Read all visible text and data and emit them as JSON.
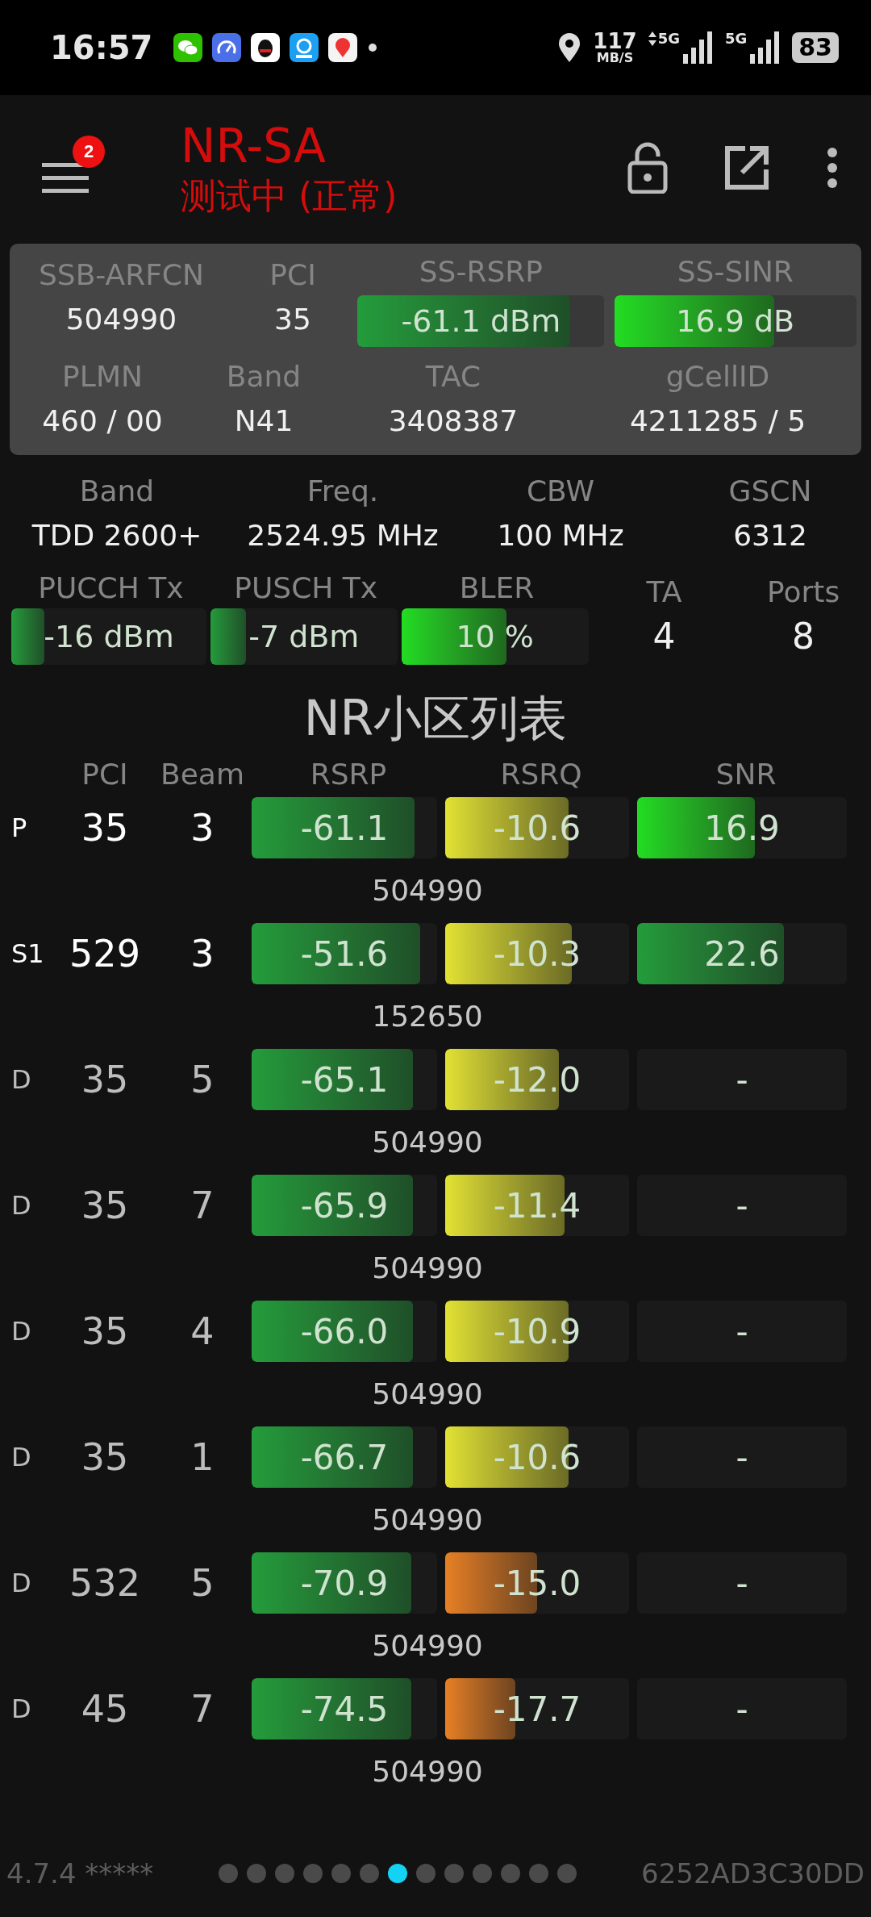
{
  "status_bar": {
    "time": "16:57",
    "net_speed": "117",
    "net_speed_unit": "MB/S",
    "signal_labels": [
      "5G",
      "5G"
    ],
    "battery": "83"
  },
  "app_bar": {
    "menu_badge": "2",
    "title": "NR-SA",
    "subtitle": "测试中 (正常)"
  },
  "serving_cell": {
    "row_1": [
      {
        "label": "SSB-ARFCN",
        "value": "504990"
      },
      {
        "label": "PCI",
        "value": "35"
      },
      {
        "label": "SS-RSRP",
        "value": "-61.1 dBm",
        "level": 0.86,
        "color": "#239c3b"
      },
      {
        "label": "SS-SINR",
        "value": "16.9 dB",
        "level": 0.66,
        "color": "#22dd22"
      }
    ],
    "row_2": [
      {
        "label": "PLMN",
        "value": "460 / 00"
      },
      {
        "label": "Band",
        "value": "N41"
      },
      {
        "label": "TAC",
        "value": "3408387"
      },
      {
        "label": "gCellID",
        "value": "4211285 / 5"
      }
    ]
  },
  "carrier": {
    "row_1": [
      {
        "label": "Band",
        "value": "TDD 2600+"
      },
      {
        "label": "Freq.",
        "value": "2524.95 MHz"
      },
      {
        "label": "CBW",
        "value": "100 MHz"
      },
      {
        "label": "GSCN",
        "value": "6312"
      }
    ],
    "row_2": [
      {
        "label": "PUCCH Tx",
        "value": "-16 dBm",
        "level": 0.17,
        "color": "#239c3b"
      },
      {
        "label": "PUSCH Tx",
        "value": "-7 dBm",
        "level": 0.19,
        "color": "#239c3b"
      },
      {
        "label": "BLER",
        "value": "10 %",
        "level": 0.56,
        "color": "#22dd22"
      },
      {
        "label": "TA",
        "value": "4"
      },
      {
        "label": "Ports",
        "value": "8"
      }
    ]
  },
  "cell_list": {
    "title": "NR小区列表",
    "columns": [
      "PCI",
      "Beam",
      "RSRP",
      "RSRQ",
      "SNR"
    ],
    "rows": [
      {
        "type": "P",
        "kind": "serving",
        "pci": "35",
        "beam": "3",
        "rsrp": {
          "value": "-61.1",
          "level": 0.88,
          "color": "#239c3b"
        },
        "rsrq": {
          "value": "-10.6",
          "level": 0.67,
          "color": "#e2e234"
        },
        "snr": {
          "value": "16.9",
          "level": 0.56,
          "color": "#22dd22"
        },
        "arfcn": "504990"
      },
      {
        "type": "S1",
        "kind": "serving",
        "pci": "529",
        "beam": "3",
        "rsrp": {
          "value": "-51.6",
          "level": 0.91,
          "color": "#239c3b"
        },
        "rsrq": {
          "value": "-10.3",
          "level": 0.69,
          "color": "#e2e234"
        },
        "snr": {
          "value": "22.6",
          "level": 0.7,
          "color": "#239c3b"
        },
        "arfcn": "152650"
      },
      {
        "type": "D",
        "kind": "neighbor",
        "pci": "35",
        "beam": "5",
        "rsrp": {
          "value": "-65.1",
          "level": 0.87,
          "color": "#239c3b"
        },
        "rsrq": {
          "value": "-12.0",
          "level": 0.62,
          "color": "#e2e234"
        },
        "snr": {
          "value": "-"
        },
        "arfcn": "504990"
      },
      {
        "type": "D",
        "kind": "neighbor",
        "pci": "35",
        "beam": "7",
        "rsrp": {
          "value": "-65.9",
          "level": 0.87,
          "color": "#239c3b"
        },
        "rsrq": {
          "value": "-11.4",
          "level": 0.65,
          "color": "#e2e234"
        },
        "snr": {
          "value": "-"
        },
        "arfcn": "504990"
      },
      {
        "type": "D",
        "kind": "neighbor",
        "pci": "35",
        "beam": "4",
        "rsrp": {
          "value": "-66.0",
          "level": 0.87,
          "color": "#239c3b"
        },
        "rsrq": {
          "value": "-10.9",
          "level": 0.67,
          "color": "#e2e234"
        },
        "snr": {
          "value": "-"
        },
        "arfcn": "504990"
      },
      {
        "type": "D",
        "kind": "neighbor",
        "pci": "35",
        "beam": "1",
        "rsrp": {
          "value": "-66.7",
          "level": 0.87,
          "color": "#239c3b"
        },
        "rsrq": {
          "value": "-10.6",
          "level": 0.67,
          "color": "#e2e234"
        },
        "snr": {
          "value": "-"
        },
        "arfcn": "504990"
      },
      {
        "type": "D",
        "kind": "neighbor",
        "pci": "532",
        "beam": "5",
        "rsrp": {
          "value": "-70.9",
          "level": 0.86,
          "color": "#239c3b"
        },
        "rsrq": {
          "value": "-15.0",
          "level": 0.5,
          "color": "#e88024"
        },
        "snr": {
          "value": "-"
        },
        "arfcn": "504990"
      },
      {
        "type": "D",
        "kind": "neighbor",
        "pci": "45",
        "beam": "7",
        "rsrp": {
          "value": "-74.5",
          "level": 0.86,
          "color": "#239c3b"
        },
        "rsrq": {
          "value": "-17.7",
          "level": 0.38,
          "color": "#e88024"
        },
        "snr": {
          "value": "-"
        },
        "arfcn": "504990"
      }
    ]
  },
  "footer": {
    "version": "4.7.4 *****",
    "pages": [
      {
        "selected": false
      },
      {
        "selected": false
      },
      {
        "selected": false
      },
      {
        "selected": false
      },
      {
        "selected": false
      },
      {
        "selected": false
      },
      {
        "selected": true
      },
      {
        "selected": false
      },
      {
        "selected": false
      },
      {
        "selected": false
      },
      {
        "selected": false
      },
      {
        "selected": false
      },
      {
        "selected": false
      }
    ],
    "device_id": "6252AD3C30DD"
  }
}
